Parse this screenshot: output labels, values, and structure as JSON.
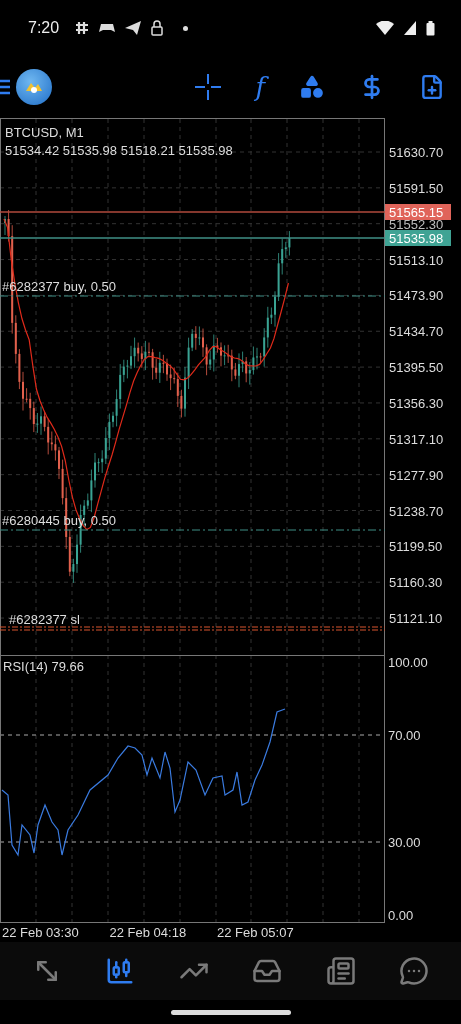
{
  "status_bar": {
    "time": "7:20"
  },
  "toolbar": {
    "function_glyph": "f"
  },
  "chart": {
    "symbol": "BTCUSD, M1",
    "ohlc": "51534.42 51535.98 51518.21 51535.98",
    "price_labels": [
      "51630.70",
      "51591.50",
      "51552.30",
      "51513.10",
      "51473.90",
      "51434.70",
      "51395.50",
      "51356.30",
      "51317.10",
      "51277.90",
      "51238.70",
      "51199.50",
      "51160.30",
      "51121.10"
    ],
    "levels": [
      {
        "kind": "ask",
        "label": "51565.15"
      },
      {
        "kind": "bid",
        "label": "51535.98"
      }
    ],
    "orders": [
      {
        "kind": "buy",
        "label": "#6282377 buy, 0.50"
      },
      {
        "kind": "buy",
        "label": "#6280445 buy, 0.50"
      },
      {
        "kind": "sl",
        "label": "#6282377 sl"
      }
    ]
  },
  "indicator": {
    "title": "RSI(14) 79.66",
    "labels": [
      "100.00",
      "70.00",
      "30.00",
      "0.00"
    ]
  },
  "time_labels": [
    "22 Feb 03:30",
    "22 Feb 04:18",
    "22 Feb 05:07"
  ],
  "bottom_nav": [
    {
      "kind": "trade",
      "selected": false
    },
    {
      "kind": "chart",
      "selected": true
    },
    {
      "kind": "trend",
      "selected": false
    },
    {
      "kind": "inbox",
      "selected": false
    },
    {
      "kind": "news",
      "selected": false
    },
    {
      "kind": "chat",
      "selected": false
    }
  ]
}
